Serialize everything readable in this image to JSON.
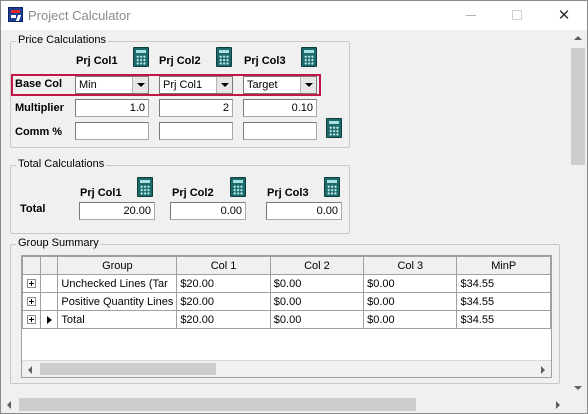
{
  "window": {
    "title": "Project Calculator",
    "close_glyph": "✕"
  },
  "price": {
    "group_label": "Price Calculations",
    "col_headers": [
      "Prj Col1",
      "Prj Col2",
      "Prj Col3"
    ],
    "base_col_label": "Base Col",
    "base_col_values": [
      "Min",
      "Prj Col1",
      "Target"
    ],
    "multiplier_label": "Multiplier",
    "multiplier_values": [
      "1.0",
      "2",
      "0.10"
    ],
    "comm_label": "Comm %",
    "comm_values": [
      "",
      "",
      ""
    ]
  },
  "total": {
    "group_label": "Total Calculations",
    "col_headers": [
      "Prj Col1",
      "Prj Col2",
      "Prj Col3"
    ],
    "total_label": "Total",
    "values": [
      "20.00",
      "0.00",
      "0.00"
    ]
  },
  "summary": {
    "group_label": "Group Summary",
    "columns": [
      "Group",
      "Col 1",
      "Col 2",
      "Col 3",
      "MinP"
    ],
    "rows": [
      {
        "group": "Unchecked Lines (Tar",
        "col1": "$20.00",
        "col2": "$0.00",
        "col3": "$0.00",
        "minp": "$34.55"
      },
      {
        "group": "Positive Quantity Lines",
        "col1": "$20.00",
        "col2": "$0.00",
        "col3": "$0.00",
        "minp": "$34.55"
      },
      {
        "group": "Total",
        "col1": "$20.00",
        "col2": "$0.00",
        "col3": "$0.00",
        "minp": "$34.55"
      }
    ]
  },
  "colors": {
    "highlight": "#c01746",
    "calc_icon": "#1c6a6a",
    "brand_icon": "#1c3f93"
  },
  "icons": [
    "app-logo-icon",
    "calculator-icon",
    "dropdown-arrow-icon",
    "expand-plus-icon",
    "row-pointer-icon"
  ]
}
